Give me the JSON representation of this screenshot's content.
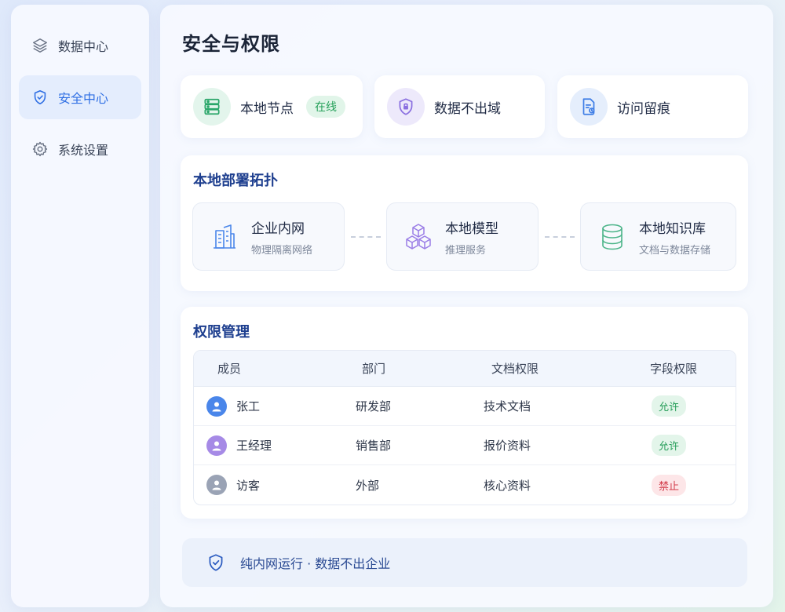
{
  "sidebar": {
    "items": [
      {
        "label": "数据中心",
        "icon": "layers-icon",
        "active": false
      },
      {
        "label": "安全中心",
        "icon": "shield-check-icon",
        "active": true
      },
      {
        "label": "系统设置",
        "icon": "gear-icon",
        "active": false
      }
    ]
  },
  "page": {
    "title": "安全与权限"
  },
  "stats": [
    {
      "label": "本地节点",
      "icon": "server-icon",
      "badge": "在线"
    },
    {
      "label": "数据不出域",
      "icon": "shield-lock-icon"
    },
    {
      "label": "访问留痕",
      "icon": "document-audit-icon"
    }
  ],
  "topology": {
    "title": "本地部署拓扑",
    "nodes": [
      {
        "name": "企业内网",
        "sub": "物理隔离网络",
        "icon": "building-icon"
      },
      {
        "name": "本地模型",
        "sub": "推理服务",
        "icon": "cubes-icon"
      },
      {
        "name": "本地知识库",
        "sub": "文档与数据存储",
        "icon": "database-icon"
      }
    ]
  },
  "permissions": {
    "title": "权限管理",
    "headers": [
      "成员",
      "部门",
      "文档权限",
      "字段权限"
    ],
    "rows": [
      {
        "member": "张工",
        "dept": "研发部",
        "doc": "技术文档",
        "field": "允许",
        "status": "allow",
        "avatar_color": "#4a86ea"
      },
      {
        "member": "王经理",
        "dept": "销售部",
        "doc": "报价资料",
        "field": "允许",
        "status": "allow",
        "avatar_color": "#a68ae6"
      },
      {
        "member": "访客",
        "dept": "外部",
        "doc": "核心资料",
        "field": "禁止",
        "status": "deny",
        "avatar_color": "#9aa3b5"
      }
    ]
  },
  "footer": {
    "text": "纯内网运行 · 数据不出企业",
    "icon": "shield-check-icon"
  },
  "colors": {
    "accent": "#2f6fe4",
    "allow": "#259d58",
    "deny": "#d23a48",
    "online": "#26a05a"
  }
}
